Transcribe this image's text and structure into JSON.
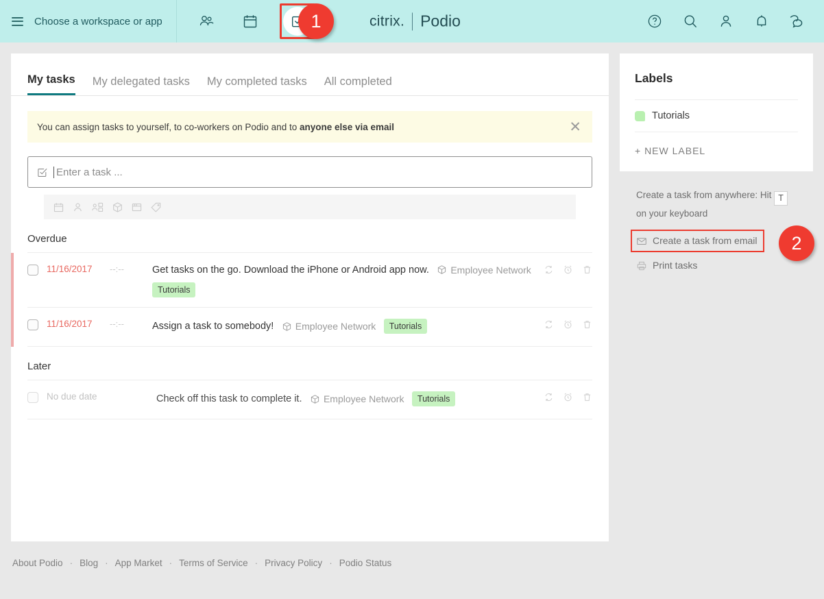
{
  "topbar": {
    "menu_icon": "hamburger-icon",
    "workspace_label": "Choose a workspace or app",
    "nav": [
      {
        "name": "people-icon",
        "label": "People"
      },
      {
        "name": "calendar-icon",
        "label": "Calendar"
      },
      {
        "name": "tasks-icon",
        "label": "Tasks"
      }
    ],
    "brand": {
      "citrix": "citrix.",
      "podio": "Podio"
    },
    "right_icons": [
      {
        "name": "help-icon",
        "label": "Help"
      },
      {
        "name": "search-icon",
        "label": "Search"
      },
      {
        "name": "profile-icon",
        "label": "Profile"
      },
      {
        "name": "notifications-icon",
        "label": "Notifications"
      },
      {
        "name": "chat-icon",
        "label": "Chat"
      }
    ]
  },
  "annotations": {
    "badge_1": "1",
    "badge_2": "2",
    "highlight_color": "#ec3b2e",
    "badge_color": "#ef3b30"
  },
  "tabs": [
    {
      "label": "My tasks",
      "active": true
    },
    {
      "label": "My delegated tasks",
      "active": false
    },
    {
      "label": "My completed tasks",
      "active": false
    },
    {
      "label": "All completed",
      "active": false
    }
  ],
  "banner": {
    "text_plain": "You can assign tasks to yourself, to co-workers on Podio and to ",
    "text_bold": "anyone else via email",
    "close_icon": "close-icon"
  },
  "task_input": {
    "placeholder": "Enter a task ...",
    "check_icon": "checkbox-check-icon",
    "toolbar_icons": [
      "calendar-icon",
      "assign-person-icon",
      "delegate-icon",
      "space-cube-icon",
      "app-window-icon",
      "label-tag-icon"
    ]
  },
  "sections": [
    {
      "heading": "Overdue",
      "tasks": [
        {
          "checked": false,
          "due_date": "11/16/2017",
          "due_time": "--:--",
          "overdue": true,
          "title": "Get tasks on the go. Download the iPhone or Android app now.",
          "space": "Employee Network",
          "label": "Tutorials",
          "label_below": true,
          "actions": [
            "repeat-icon",
            "reminder-icon",
            "delete-icon"
          ]
        },
        {
          "checked": false,
          "due_date": "11/16/2017",
          "due_time": "--:--",
          "overdue": true,
          "title": "Assign a task to somebody!",
          "space": "Employee Network",
          "label": "Tutorials",
          "label_below": false,
          "actions": [
            "repeat-icon",
            "reminder-icon",
            "delete-icon"
          ]
        }
      ]
    },
    {
      "heading": "Later",
      "tasks": [
        {
          "checked": false,
          "due_date": "No due date",
          "due_time": "",
          "overdue": false,
          "title": "Check off this task to complete it.",
          "space": "Employee Network",
          "label": "Tutorials",
          "label_below": false,
          "actions": [
            "repeat-icon",
            "reminder-icon",
            "delete-icon"
          ]
        }
      ]
    }
  ],
  "labels_panel": {
    "title": "Labels",
    "items": [
      {
        "name": "Tutorials",
        "color": "#b9f0b0"
      }
    ],
    "new_label": "+ NEW LABEL"
  },
  "helper": {
    "shortcut_prefix": "Create a task from anywhere: Hit",
    "shortcut_key": "T",
    "shortcut_suffix": "on your keyboard",
    "email_link": "Create a task from email",
    "email_icon": "envelope-icon",
    "print_link": "Print tasks",
    "print_icon": "printer-icon"
  },
  "footer": {
    "links": [
      "About Podio",
      "Blog",
      "App Market",
      "Terms of Service",
      "Privacy Policy",
      "Podio Status"
    ],
    "separator": "·"
  }
}
